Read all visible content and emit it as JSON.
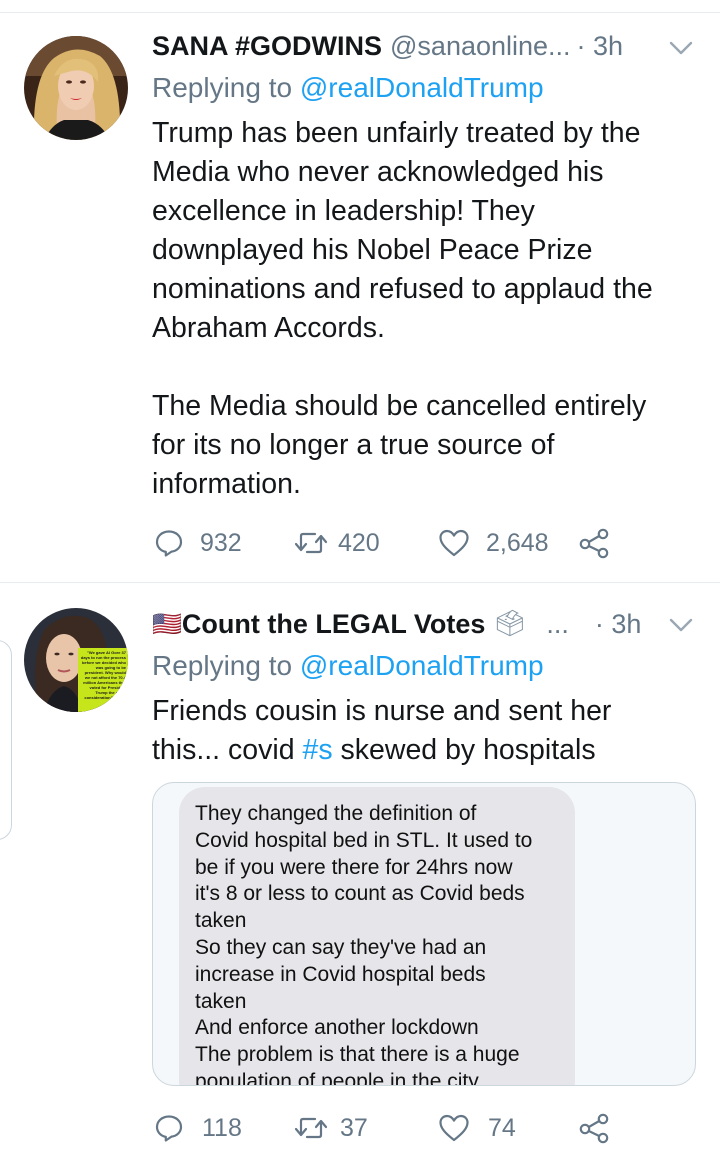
{
  "tweets": [
    {
      "name": "SANA #GODWINS",
      "handle": "@sanaonline...",
      "time": "· 3h",
      "reply_prefix": "Replying to",
      "reply_to": "@realDonaldTrump",
      "text_lines": [
        "Trump has been unfairly treated by the",
        "Media who never acknowledged his",
        "excellence in leadership! They",
        "downplayed his Nobel Peace Prize",
        "nominations and refused to applaud the",
        "Abraham Accords.",
        "",
        "The Media should be cancelled entirely",
        "for its no longer a true source of",
        "information."
      ],
      "replies": "932",
      "retweets": "420",
      "likes": "2,648"
    },
    {
      "name_flag": "🇺🇸",
      "name": "Count the LEGAL Votes",
      "name_ballot": "🗳",
      "handle": "...",
      "time": "· 3h",
      "reply_prefix": "Replying to",
      "reply_to": "@realDonaldTrump",
      "text_line1": "Friends cousin is nurse and sent her",
      "text_line2_before": "this... covid ",
      "text_line2_hashtag": "#s",
      "text_line2_after": " skewed by hospitals",
      "avatar_caption": "\"We gave Al Gore 37 days to run the process before we decided who was going to be president. Why would we not afford the 70.4 million Americans that voted for President Trump the same consideration?\" -Gov. Kristi",
      "media_text_lines": [
        "They changed the definition of",
        "Covid hospital bed in STL. It used to",
        "be if you were there for 24hrs now",
        "it's 8 or less to count as Covid beds",
        "taken",
        "So they can say they've had an",
        "increase in Covid hospital beds",
        "taken",
        "And enforce another lockdown",
        "The problem is that there is a huge",
        "population of people in the city"
      ],
      "replies": "118",
      "retweets": "37",
      "likes": "74"
    }
  ],
  "icons": {
    "reply": "reply-icon",
    "retweet": "retweet-icon",
    "like": "heart-icon",
    "share": "share-icon",
    "more": "chevron-down-icon"
  },
  "colors": {
    "link": "#1da1f2",
    "muted": "#657786",
    "text": "#14171a",
    "divider": "#e6ecf0",
    "avatar_caption_bg": "#c6e51a"
  }
}
